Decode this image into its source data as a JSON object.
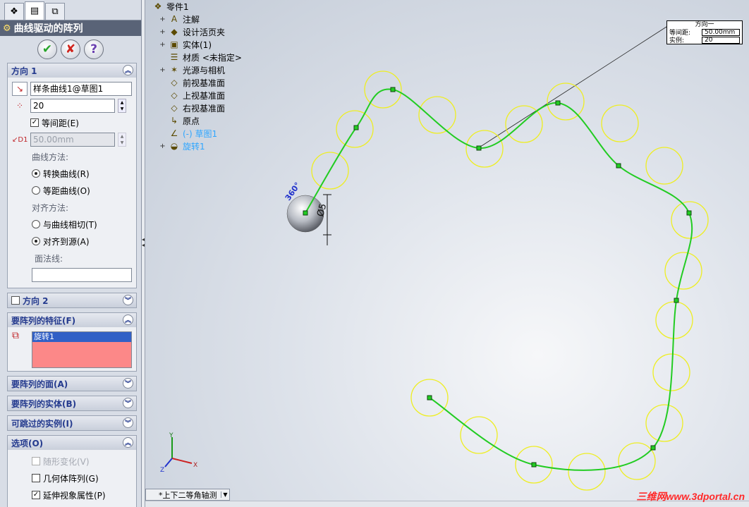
{
  "property_manager": {
    "tabs": [
      "feature-manager",
      "property-manager",
      "configuration-manager"
    ],
    "title": "曲线驱动的阵列",
    "buttons": {
      "ok": "✔",
      "cancel": "✘",
      "help": "?"
    },
    "direction1": {
      "header": "方向 1",
      "curve": "样条曲线1@草图1",
      "count": "20",
      "equal_spacing_label": "等间距(E)",
      "equal_spacing_checked": true,
      "spacing": "50.00mm",
      "curve_method_label": "曲线方法:",
      "curve_method_options": [
        "转换曲线(R)",
        "等距曲线(O)"
      ],
      "align_method_label": "对齐方法:",
      "align_method_options": [
        "与曲线相切(T)",
        "对齐到源(A)"
      ],
      "face_normal_label": "面法线:",
      "face_normal_value": ""
    },
    "direction2": {
      "header": "方向 2"
    },
    "features": {
      "header": "要阵列的特征(F)",
      "items": [
        "旋转1"
      ]
    },
    "faces": {
      "header": "要阵列的面(A)"
    },
    "bodies": {
      "header": "要阵列的实体(B)"
    },
    "skip": {
      "header": "可跳过的实例(I)"
    },
    "options": {
      "header": "选项(O)",
      "items": [
        {
          "label": "随形变化(V)",
          "checked": false,
          "disabled": true
        },
        {
          "label": "几何体阵列(G)",
          "checked": false,
          "disabled": false
        },
        {
          "label": "延伸视象属性(P)",
          "checked": true,
          "disabled": false
        }
      ]
    }
  },
  "tree": {
    "root": "零件1",
    "items": [
      {
        "label": "注解",
        "expand": "+",
        "icon": "A"
      },
      {
        "label": "设计活页夹",
        "expand": "+",
        "icon": "◆"
      },
      {
        "label": "实体(1)",
        "expand": "+",
        "icon": "▣"
      },
      {
        "label": "材质 <未指定>",
        "expand": "",
        "icon": "☰"
      },
      {
        "label": "光源与相机",
        "expand": "+",
        "icon": "✶"
      },
      {
        "label": "前视基准面",
        "expand": "",
        "icon": "◇"
      },
      {
        "label": "上视基准面",
        "expand": "",
        "icon": "◇"
      },
      {
        "label": "右视基准面",
        "expand": "",
        "icon": "◇"
      },
      {
        "label": "原点",
        "expand": "",
        "icon": "↳"
      },
      {
        "label": "(-) 草图1",
        "expand": "",
        "icon": "∠",
        "selected": true
      },
      {
        "label": "旋转1",
        "expand": "+",
        "icon": "◒",
        "selected": true
      }
    ]
  },
  "callout": {
    "title": "方向一",
    "spacing_label": "等间距:",
    "spacing_value": "50.00mm",
    "instances_label": "实例:",
    "instances_value": "20"
  },
  "view_tab": "*上下二等角轴测",
  "watermark": "三维网www.3dportal.cn",
  "triad": {
    "x": "X",
    "y": "Y",
    "z": "Z"
  },
  "colors": {
    "curve": "#22cc22",
    "instance": "#eeee22",
    "title_bar": "#596377",
    "accent": "#243a8e"
  }
}
